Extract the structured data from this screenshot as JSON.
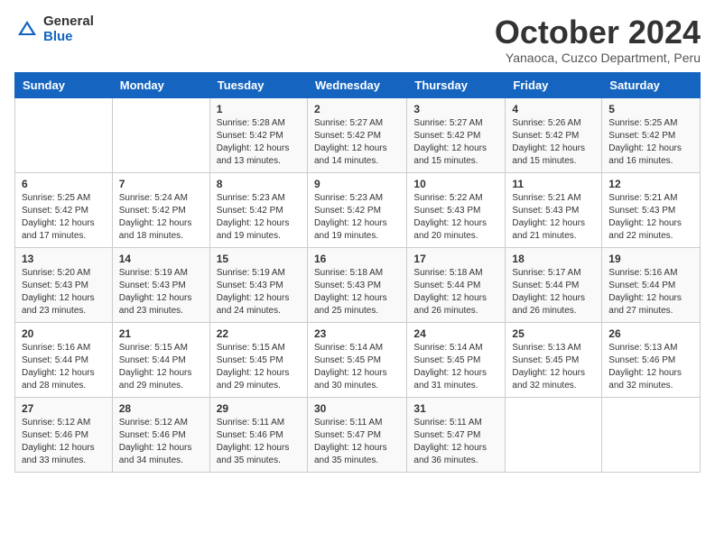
{
  "logo": {
    "general": "General",
    "blue": "Blue"
  },
  "header": {
    "month": "October 2024",
    "location": "Yanaoca, Cuzco Department, Peru"
  },
  "weekdays": [
    "Sunday",
    "Monday",
    "Tuesday",
    "Wednesday",
    "Thursday",
    "Friday",
    "Saturday"
  ],
  "weeks": [
    [
      {
        "day": "",
        "sunrise": "",
        "sunset": "",
        "daylight": ""
      },
      {
        "day": "",
        "sunrise": "",
        "sunset": "",
        "daylight": ""
      },
      {
        "day": "1",
        "sunrise": "Sunrise: 5:28 AM",
        "sunset": "Sunset: 5:42 PM",
        "daylight": "Daylight: 12 hours and 13 minutes."
      },
      {
        "day": "2",
        "sunrise": "Sunrise: 5:27 AM",
        "sunset": "Sunset: 5:42 PM",
        "daylight": "Daylight: 12 hours and 14 minutes."
      },
      {
        "day": "3",
        "sunrise": "Sunrise: 5:27 AM",
        "sunset": "Sunset: 5:42 PM",
        "daylight": "Daylight: 12 hours and 15 minutes."
      },
      {
        "day": "4",
        "sunrise": "Sunrise: 5:26 AM",
        "sunset": "Sunset: 5:42 PM",
        "daylight": "Daylight: 12 hours and 15 minutes."
      },
      {
        "day": "5",
        "sunrise": "Sunrise: 5:25 AM",
        "sunset": "Sunset: 5:42 PM",
        "daylight": "Daylight: 12 hours and 16 minutes."
      }
    ],
    [
      {
        "day": "6",
        "sunrise": "Sunrise: 5:25 AM",
        "sunset": "Sunset: 5:42 PM",
        "daylight": "Daylight: 12 hours and 17 minutes."
      },
      {
        "day": "7",
        "sunrise": "Sunrise: 5:24 AM",
        "sunset": "Sunset: 5:42 PM",
        "daylight": "Daylight: 12 hours and 18 minutes."
      },
      {
        "day": "8",
        "sunrise": "Sunrise: 5:23 AM",
        "sunset": "Sunset: 5:42 PM",
        "daylight": "Daylight: 12 hours and 19 minutes."
      },
      {
        "day": "9",
        "sunrise": "Sunrise: 5:23 AM",
        "sunset": "Sunset: 5:42 PM",
        "daylight": "Daylight: 12 hours and 19 minutes."
      },
      {
        "day": "10",
        "sunrise": "Sunrise: 5:22 AM",
        "sunset": "Sunset: 5:43 PM",
        "daylight": "Daylight: 12 hours and 20 minutes."
      },
      {
        "day": "11",
        "sunrise": "Sunrise: 5:21 AM",
        "sunset": "Sunset: 5:43 PM",
        "daylight": "Daylight: 12 hours and 21 minutes."
      },
      {
        "day": "12",
        "sunrise": "Sunrise: 5:21 AM",
        "sunset": "Sunset: 5:43 PM",
        "daylight": "Daylight: 12 hours and 22 minutes."
      }
    ],
    [
      {
        "day": "13",
        "sunrise": "Sunrise: 5:20 AM",
        "sunset": "Sunset: 5:43 PM",
        "daylight": "Daylight: 12 hours and 23 minutes."
      },
      {
        "day": "14",
        "sunrise": "Sunrise: 5:19 AM",
        "sunset": "Sunset: 5:43 PM",
        "daylight": "Daylight: 12 hours and 23 minutes."
      },
      {
        "day": "15",
        "sunrise": "Sunrise: 5:19 AM",
        "sunset": "Sunset: 5:43 PM",
        "daylight": "Daylight: 12 hours and 24 minutes."
      },
      {
        "day": "16",
        "sunrise": "Sunrise: 5:18 AM",
        "sunset": "Sunset: 5:43 PM",
        "daylight": "Daylight: 12 hours and 25 minutes."
      },
      {
        "day": "17",
        "sunrise": "Sunrise: 5:18 AM",
        "sunset": "Sunset: 5:44 PM",
        "daylight": "Daylight: 12 hours and 26 minutes."
      },
      {
        "day": "18",
        "sunrise": "Sunrise: 5:17 AM",
        "sunset": "Sunset: 5:44 PM",
        "daylight": "Daylight: 12 hours and 26 minutes."
      },
      {
        "day": "19",
        "sunrise": "Sunrise: 5:16 AM",
        "sunset": "Sunset: 5:44 PM",
        "daylight": "Daylight: 12 hours and 27 minutes."
      }
    ],
    [
      {
        "day": "20",
        "sunrise": "Sunrise: 5:16 AM",
        "sunset": "Sunset: 5:44 PM",
        "daylight": "Daylight: 12 hours and 28 minutes."
      },
      {
        "day": "21",
        "sunrise": "Sunrise: 5:15 AM",
        "sunset": "Sunset: 5:44 PM",
        "daylight": "Daylight: 12 hours and 29 minutes."
      },
      {
        "day": "22",
        "sunrise": "Sunrise: 5:15 AM",
        "sunset": "Sunset: 5:45 PM",
        "daylight": "Daylight: 12 hours and 29 minutes."
      },
      {
        "day": "23",
        "sunrise": "Sunrise: 5:14 AM",
        "sunset": "Sunset: 5:45 PM",
        "daylight": "Daylight: 12 hours and 30 minutes."
      },
      {
        "day": "24",
        "sunrise": "Sunrise: 5:14 AM",
        "sunset": "Sunset: 5:45 PM",
        "daylight": "Daylight: 12 hours and 31 minutes."
      },
      {
        "day": "25",
        "sunrise": "Sunrise: 5:13 AM",
        "sunset": "Sunset: 5:45 PM",
        "daylight": "Daylight: 12 hours and 32 minutes."
      },
      {
        "day": "26",
        "sunrise": "Sunrise: 5:13 AM",
        "sunset": "Sunset: 5:46 PM",
        "daylight": "Daylight: 12 hours and 32 minutes."
      }
    ],
    [
      {
        "day": "27",
        "sunrise": "Sunrise: 5:12 AM",
        "sunset": "Sunset: 5:46 PM",
        "daylight": "Daylight: 12 hours and 33 minutes."
      },
      {
        "day": "28",
        "sunrise": "Sunrise: 5:12 AM",
        "sunset": "Sunset: 5:46 PM",
        "daylight": "Daylight: 12 hours and 34 minutes."
      },
      {
        "day": "29",
        "sunrise": "Sunrise: 5:11 AM",
        "sunset": "Sunset: 5:46 PM",
        "daylight": "Daylight: 12 hours and 35 minutes."
      },
      {
        "day": "30",
        "sunrise": "Sunrise: 5:11 AM",
        "sunset": "Sunset: 5:47 PM",
        "daylight": "Daylight: 12 hours and 35 minutes."
      },
      {
        "day": "31",
        "sunrise": "Sunrise: 5:11 AM",
        "sunset": "Sunset: 5:47 PM",
        "daylight": "Daylight: 12 hours and 36 minutes."
      },
      {
        "day": "",
        "sunrise": "",
        "sunset": "",
        "daylight": ""
      },
      {
        "day": "",
        "sunrise": "",
        "sunset": "",
        "daylight": ""
      }
    ]
  ]
}
